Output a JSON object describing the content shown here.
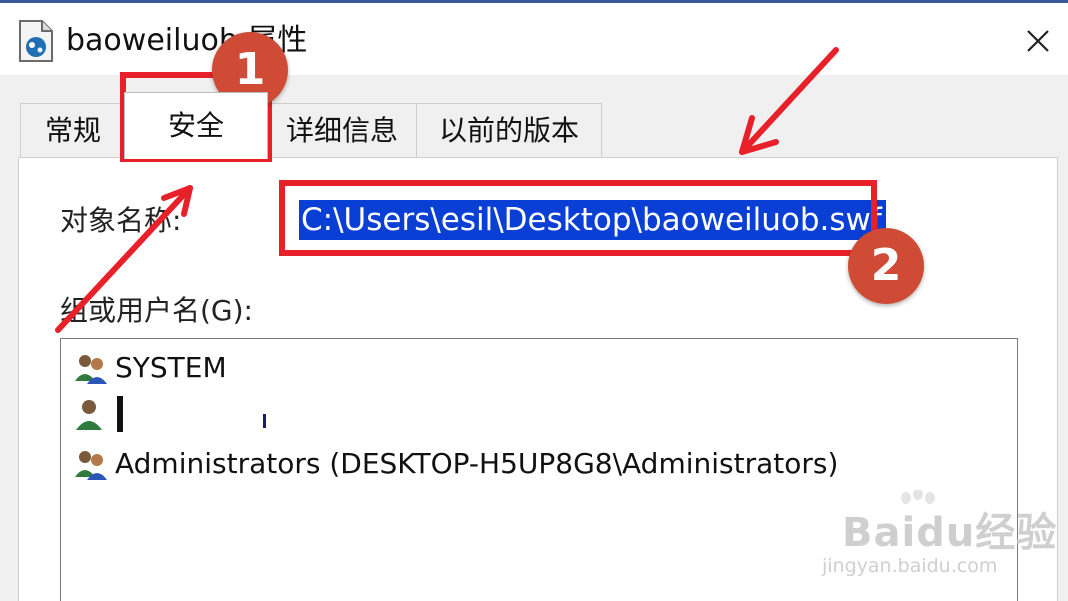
{
  "window": {
    "title": "baoweiluob 属性",
    "title_icon": "swf-file-icon",
    "close_icon": "close-icon"
  },
  "tabs": [
    {
      "label": "常规",
      "active": false
    },
    {
      "label": "安全",
      "active": true
    },
    {
      "label": "详细信息",
      "active": false
    },
    {
      "label": "以前的版本",
      "active": false
    }
  ],
  "security": {
    "object_name_label": "对象名称:",
    "object_name_value": "C:\\Users\\esil\\Desktop\\baoweiluob.swf",
    "groups_label": "组或用户名(G):",
    "groups": [
      {
        "name": "SYSTEM",
        "icon": "group-users-icon"
      },
      {
        "name": "",
        "icon": "user-icon",
        "redacted": true
      },
      {
        "name": "Administrators (DESKTOP-H5UP8G8\\Administrators)",
        "icon": "group-users-icon"
      }
    ]
  },
  "annotations": {
    "step1": "1",
    "step2": "2",
    "highlight_color": "#e8202a",
    "badge_color": "#cf4b36"
  },
  "watermark": {
    "brand": "Baidu经验",
    "url": "jingyan.baidu.com"
  }
}
